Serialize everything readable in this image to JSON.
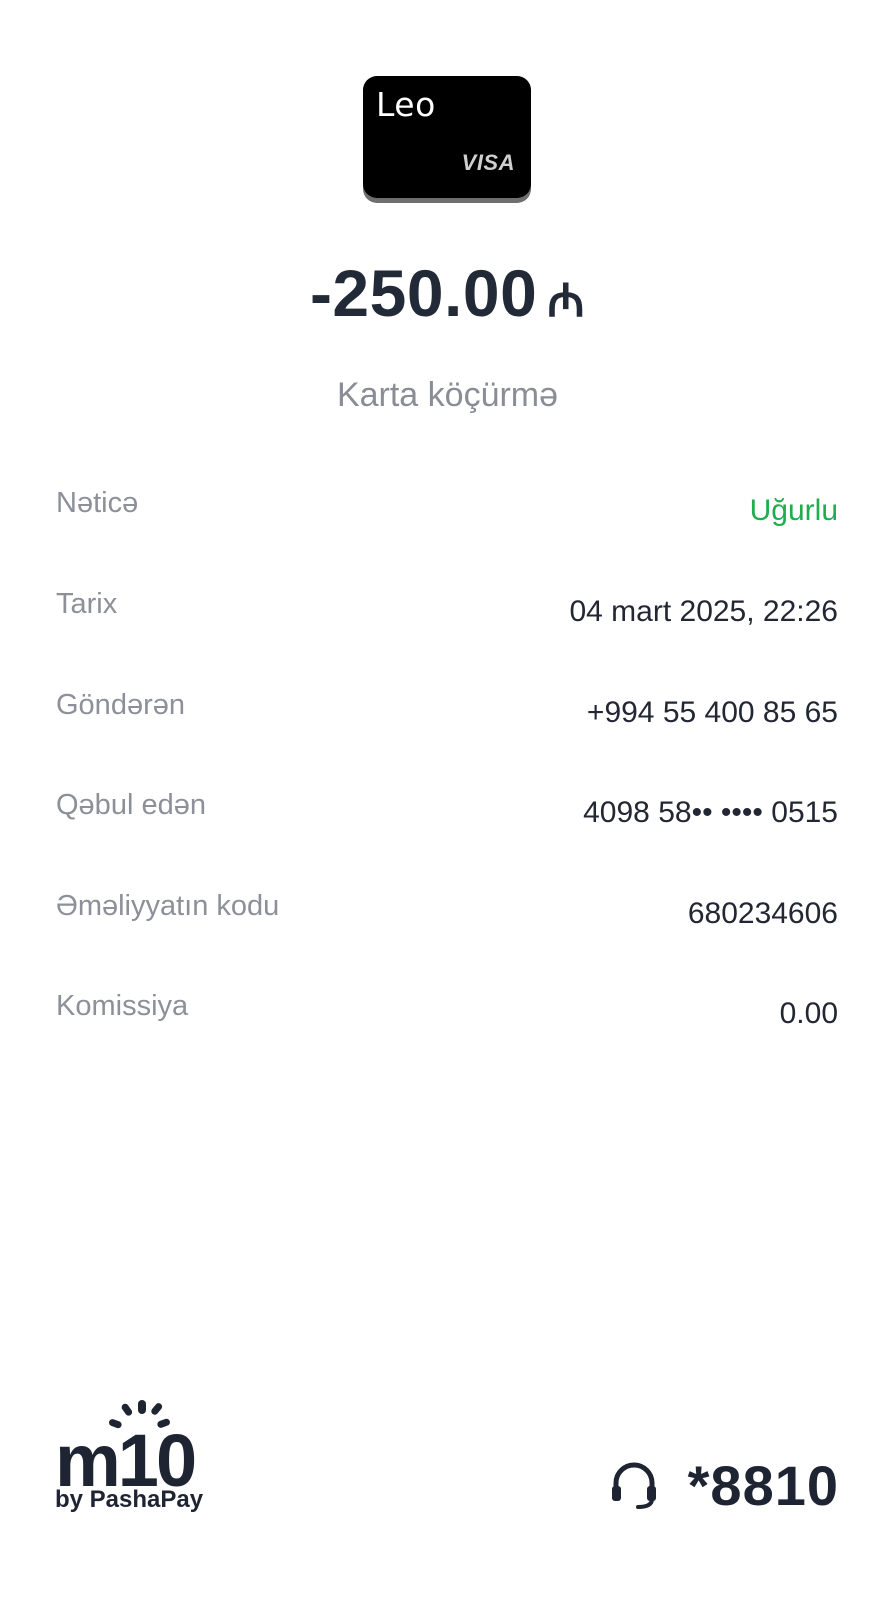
{
  "card": {
    "name": "Leo",
    "brand": "VISA"
  },
  "transaction": {
    "amount": "-250.00",
    "currency_symbol": "₼",
    "type": "Karta köçürmə"
  },
  "details": [
    {
      "label": "Nəticə",
      "value": "Uğurlu",
      "status": "success"
    },
    {
      "label": "Tarix",
      "value": "04 mart 2025, 22:26"
    },
    {
      "label": "Göndərən",
      "value": "+994 55 400 85 65"
    },
    {
      "label": "Qəbul edən",
      "value": "4098 58•• •••• 0515"
    },
    {
      "label": "Əməliyyatın kodu",
      "value": "680234606"
    },
    {
      "label": "Komissiya",
      "value": "0.00"
    }
  ],
  "footer": {
    "logo_text": "m10",
    "logo_sub": "by PashaPay",
    "support_icon": "headset-icon",
    "support_number": "*8810"
  },
  "colors": {
    "success": "#1fae4b",
    "text_primary": "#222733",
    "text_secondary": "#8d9098",
    "card_bg": "#000000"
  }
}
